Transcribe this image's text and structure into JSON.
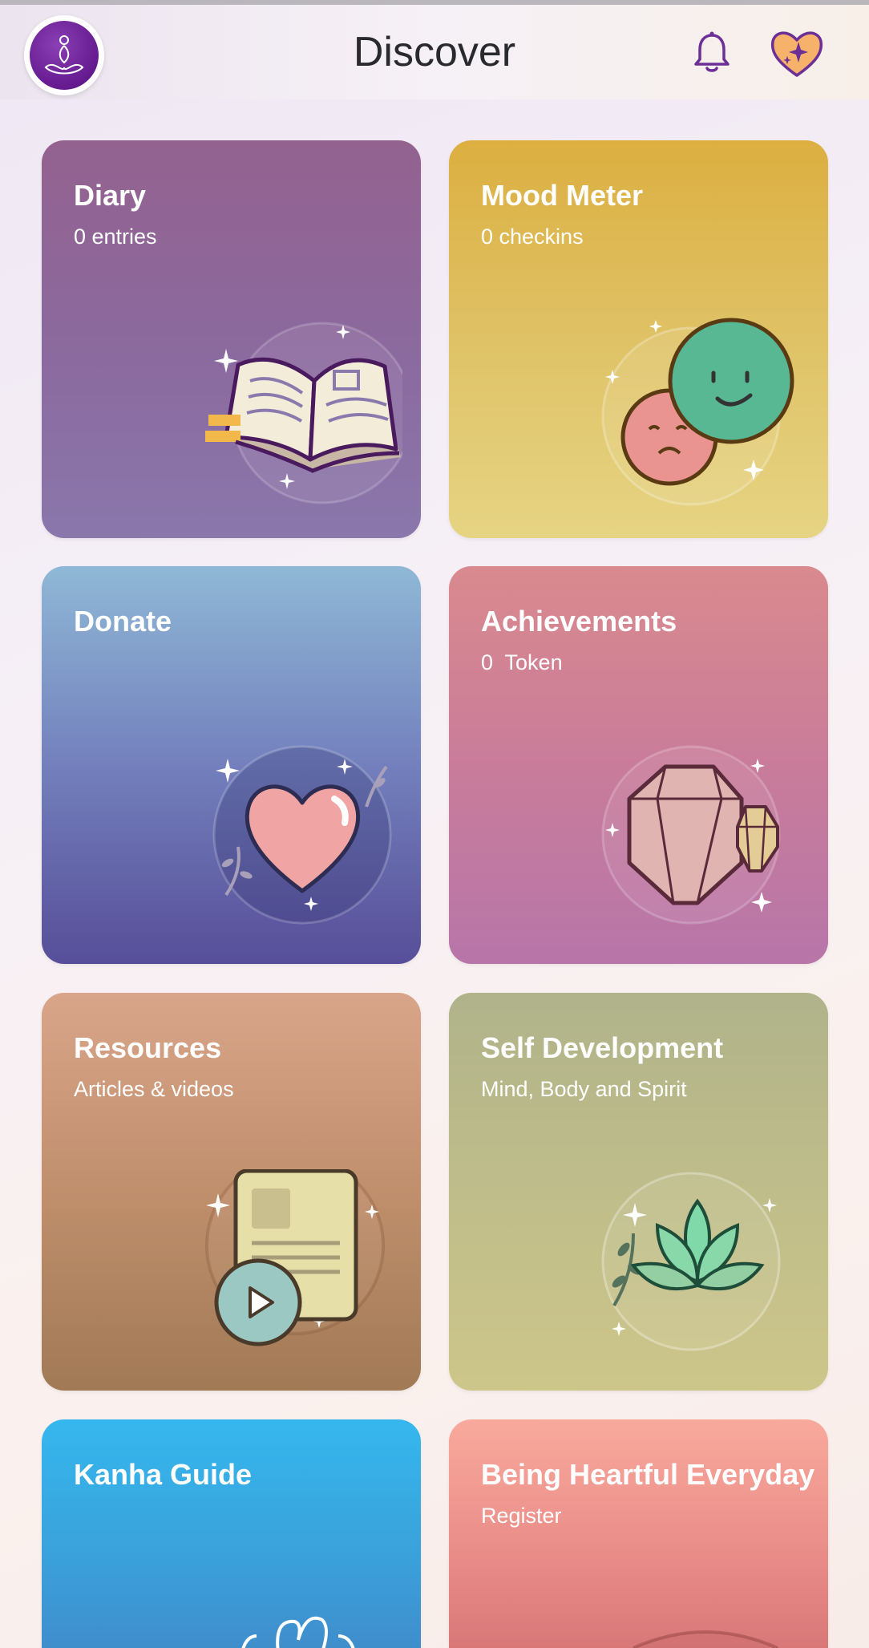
{
  "header": {
    "title": "Discover"
  },
  "cards": [
    {
      "title": "Diary",
      "subtitle": "0 entries"
    },
    {
      "title": "Mood Meter",
      "subtitle": "0 checkins"
    },
    {
      "title": "Donate",
      "subtitle": ""
    },
    {
      "title": "Achievements",
      "subtitle": "0  Token"
    },
    {
      "title": "Resources",
      "subtitle": "Articles & videos"
    },
    {
      "title": "Self Development",
      "subtitle": "Mind, Body and Spirit"
    },
    {
      "title": "Kanha Guide",
      "subtitle": ""
    },
    {
      "title": "Being Heartful Everyday",
      "subtitle": "Register"
    }
  ],
  "icons": {
    "avatar": "meditation-logo-icon",
    "notifications": "bell-icon",
    "favorites": "sparkle-heart-icon"
  },
  "colors": {
    "brand_purple": "#6b1f96",
    "bell": "#6b2f96",
    "heart_fill": "#f6b26b"
  }
}
